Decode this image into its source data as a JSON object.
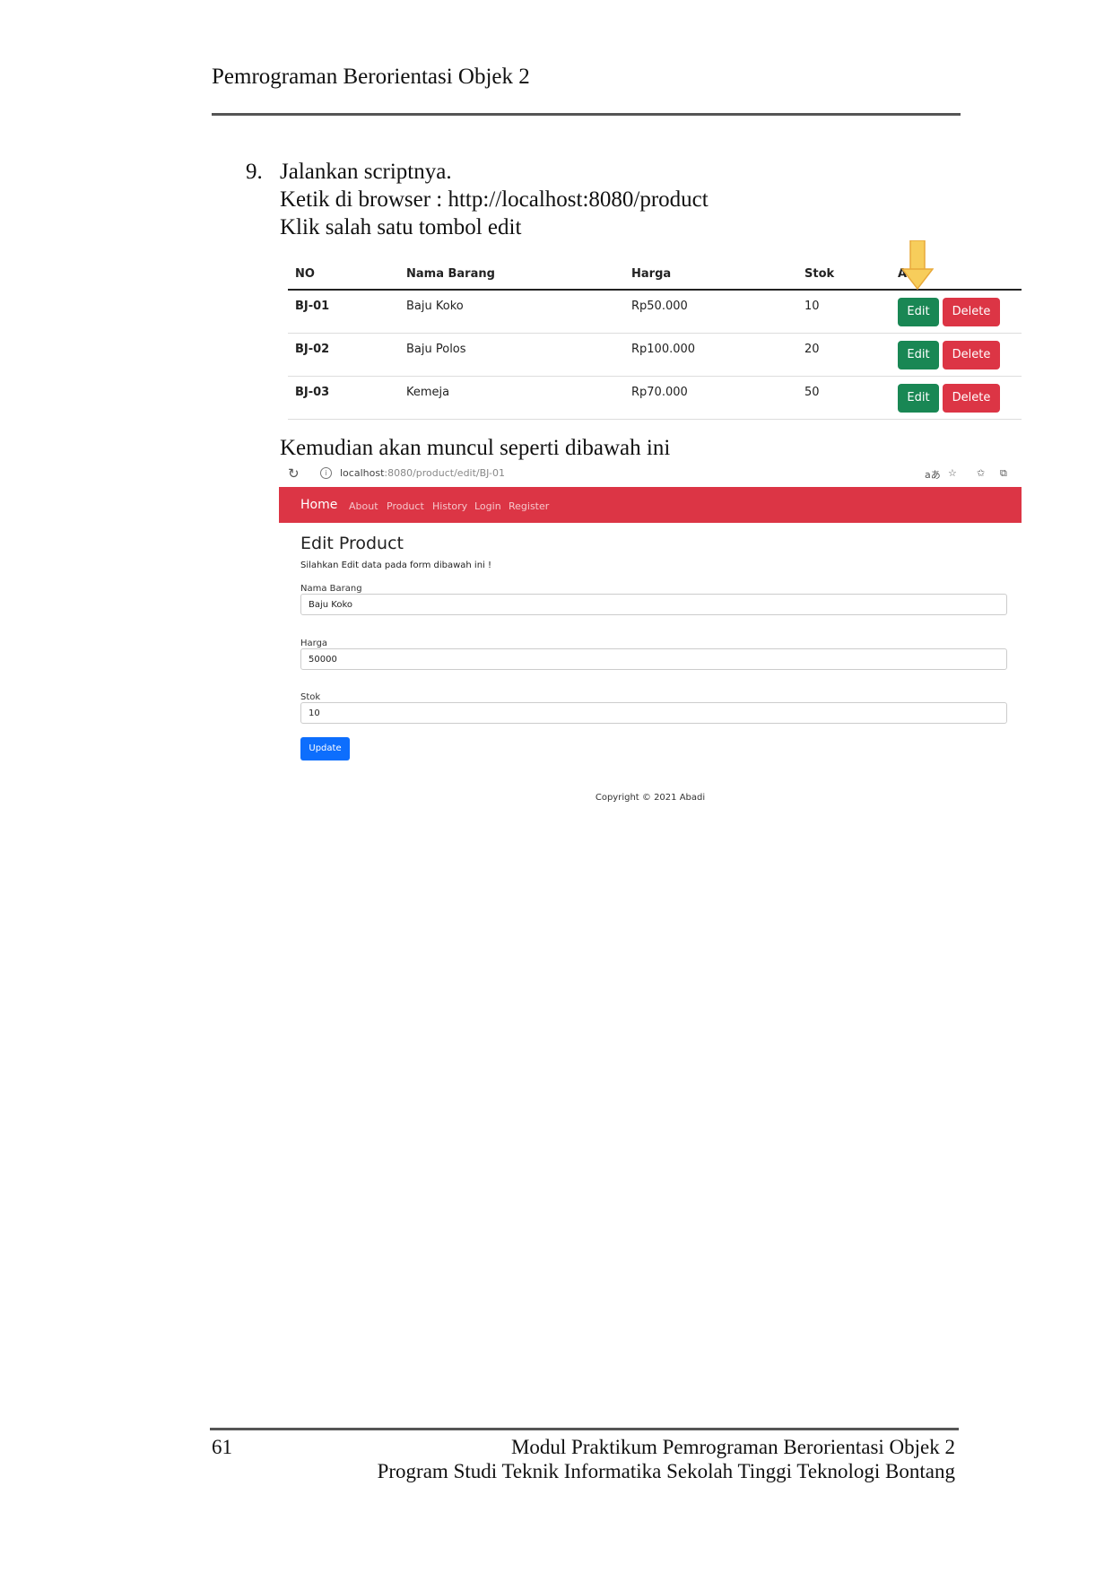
{
  "document": {
    "header_title": "Pemrograman Berorientasi Objek 2",
    "page_number": "61",
    "footer_line1": "Modul Praktikum Pemrograman Berorientasi Objek 2",
    "footer_line2": "Program Studi Teknik Informatika Sekolah Tinggi Teknologi Bontang"
  },
  "step": {
    "number": "9.",
    "line1": "Jalankan scriptnya.",
    "line2": "Ketik di browser : http://localhost:8080/product",
    "line3": "Klik salah satu tombol edit",
    "line4": "Kemudian akan muncul seperti dibawah ini"
  },
  "product_table": {
    "headers": [
      "NO",
      "Nama Barang",
      "Harga",
      "Stok",
      "A"
    ],
    "rows": [
      {
        "no": "BJ-01",
        "nama": "Baju Koko",
        "harga": "Rp50.000",
        "stok": "10"
      },
      {
        "no": "BJ-02",
        "nama": "Baju Polos",
        "harga": "Rp100.000",
        "stok": "20"
      },
      {
        "no": "BJ-03",
        "nama": "Kemeja",
        "harga": "Rp70.000",
        "stok": "50"
      }
    ],
    "edit_label": "Edit",
    "delete_label": "Delete",
    "arrow_icon": "down-arrow-icon",
    "arrow_color": "#f5c342"
  },
  "browser": {
    "url_host": "localhost",
    "url_path": ":8080/product/edit/BJ-01",
    "icons": [
      "reload-icon",
      "info-icon",
      "read-aloud-icon",
      "add-favorite-icon",
      "favorites-icon",
      "collections-icon"
    ],
    "navbar": {
      "brand": "Home",
      "items": [
        "About",
        "Product",
        "History",
        "Login",
        "Register"
      ],
      "color": "#dc3545"
    },
    "form": {
      "title": "Edit Product",
      "subtitle": "Silahkan Edit data pada form dibawah ini !",
      "fields": [
        {
          "label": "Nama Barang",
          "value": "Baju Koko"
        },
        {
          "label": "Harga",
          "value": "50000"
        },
        {
          "label": "Stok",
          "value": "10"
        }
      ],
      "submit_label": "Update"
    },
    "copyright": "Copyright © 2021 Abadi"
  }
}
